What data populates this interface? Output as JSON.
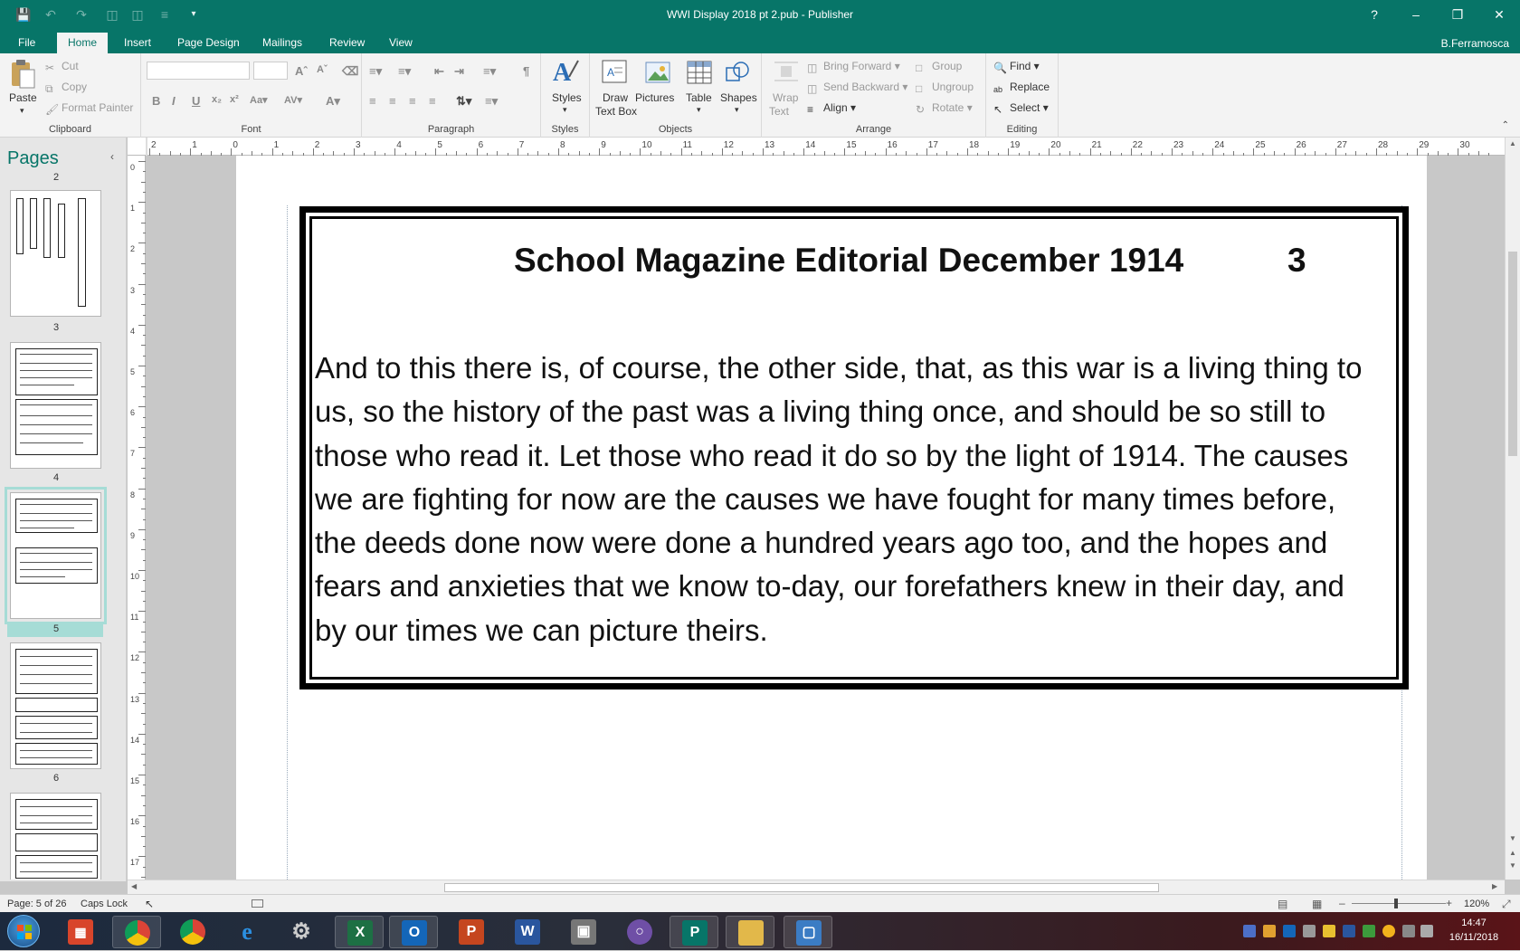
{
  "window": {
    "title": "WWI Display 2018 pt 2.pub - Publisher",
    "help": "?",
    "user": "B.Ferramosca"
  },
  "tabs": [
    {
      "label": "File"
    },
    {
      "label": "Home"
    },
    {
      "label": "Insert"
    },
    {
      "label": "Page Design"
    },
    {
      "label": "Mailings"
    },
    {
      "label": "Review"
    },
    {
      "label": "View"
    }
  ],
  "ribbon": {
    "clipboard": {
      "label": "Clipboard",
      "paste": "Paste",
      "cut": "Cut",
      "copy": "Copy",
      "format_painter": "Format Painter"
    },
    "font": {
      "label": "Font"
    },
    "paragraph": {
      "label": "Paragraph"
    },
    "styles": {
      "label": "Styles",
      "button": "Styles"
    },
    "objects": {
      "label": "Objects",
      "draw_text_box_1": "Draw",
      "draw_text_box_2": "Text Box",
      "pictures": "Pictures",
      "table": "Table",
      "shapes": "Shapes"
    },
    "arrange": {
      "label": "Arrange",
      "wrap_text_1": "Wrap",
      "wrap_text_2": "Text",
      "bring_forward": "Bring Forward",
      "send_backward": "Send Backward",
      "align": "Align",
      "group": "Group",
      "ungroup": "Ungroup",
      "rotate": "Rotate"
    },
    "editing": {
      "label": "Editing",
      "find": "Find",
      "replace": "Replace",
      "select": "Select"
    }
  },
  "pages_pane": {
    "title": "Pages",
    "thumbnails": [
      {
        "number": "2"
      },
      {
        "number": "3"
      },
      {
        "number": "4"
      },
      {
        "number": "5",
        "selected": true
      },
      {
        "number": "6"
      }
    ]
  },
  "rulers": {
    "horizontal": [
      "2",
      "1",
      "0",
      "1",
      "2",
      "3",
      "4",
      "5",
      "6",
      "7",
      "8",
      "9",
      "10",
      "11",
      "12",
      "13",
      "14",
      "15",
      "16",
      "17",
      "18",
      "19",
      "20",
      "21",
      "22",
      "23",
      "24",
      "25",
      "26",
      "27",
      "28",
      "29",
      "30"
    ],
    "vertical": [
      "0",
      "1",
      "2",
      "3",
      "4",
      "5",
      "6",
      "7",
      "8",
      "9",
      "10",
      "11",
      "12",
      "13",
      "14",
      "15",
      "16",
      "17"
    ]
  },
  "document": {
    "title": "School Magazine Editorial December 1914",
    "page_number": "3",
    "body": "And to this there is, of course, the other side, that, as this war is a living thing to us, so the history of the past was a living thing once, and should be so still to those who read it. Let those who read it do so by the light of 1914. The causes we are fighting for now are the causes we have fought for many times before, the deeds done now were done a hundred years ago too, and the hopes and fears and anxieties that we know to-day, our forefathers knew in their day, and by our times we can picture theirs."
  },
  "status": {
    "page": "Page: 5 of 26",
    "caps_lock": "Caps Lock",
    "zoom": "120%"
  },
  "taskbar": {
    "time": "14:47",
    "date": "16/11/2018"
  },
  "colors": {
    "accent": "#077568"
  }
}
